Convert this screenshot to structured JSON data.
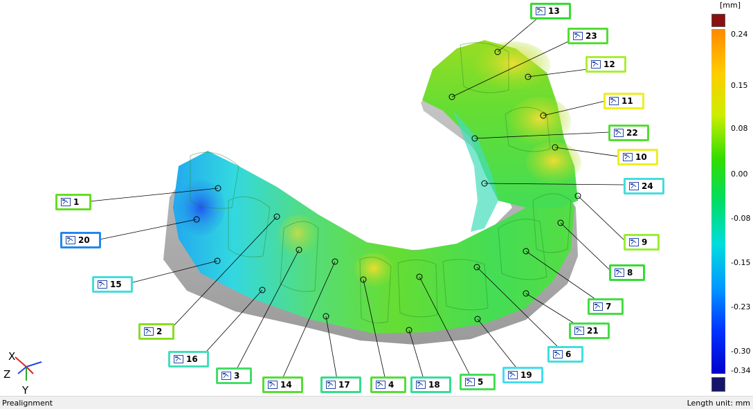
{
  "legend": {
    "unit": "[mm]",
    "ticks": [
      "0.24",
      "0.15",
      "0.08",
      "0.00",
      "-0.08",
      "-0.15",
      "-0.23",
      "-0.30",
      "-0.34"
    ],
    "colors": {
      "above": "#8b1010",
      "below": "#15156b",
      "scale": [
        "#ff8800",
        "#ffcc00",
        "#ccee00",
        "#33dd00",
        "#00dd66",
        "#00dddd",
        "#0099ff",
        "#0033ff",
        "#0000cc"
      ]
    }
  },
  "axes": {
    "x": "X",
    "y": "Y",
    "z": "Z"
  },
  "callouts": [
    {
      "id": "1",
      "color": "#66dd22"
    },
    {
      "id": "2",
      "color": "#88dd22"
    },
    {
      "id": "3",
      "color": "#44dd66"
    },
    {
      "id": "4",
      "color": "#55dd33"
    },
    {
      "id": "5",
      "color": "#44dd55"
    },
    {
      "id": "6",
      "color": "#44dddd"
    },
    {
      "id": "7",
      "color": "#44dd44"
    },
    {
      "id": "8",
      "color": "#33dd33"
    },
    {
      "id": "9",
      "color": "#99ee33"
    },
    {
      "id": "10",
      "color": "#eeee22"
    },
    {
      "id": "11",
      "color": "#eeee22"
    },
    {
      "id": "12",
      "color": "#aaee33"
    },
    {
      "id": "13",
      "color": "#33dd33"
    },
    {
      "id": "14",
      "color": "#55dd33"
    },
    {
      "id": "15",
      "color": "#44dddd"
    },
    {
      "id": "16",
      "color": "#44ddbb"
    },
    {
      "id": "17",
      "color": "#33dd88"
    },
    {
      "id": "18",
      "color": "#33dd99"
    },
    {
      "id": "19",
      "color": "#44ddee"
    },
    {
      "id": "20",
      "color": "#2288ee"
    },
    {
      "id": "21",
      "color": "#44dd44"
    },
    {
      "id": "22",
      "color": "#55dd33"
    },
    {
      "id": "23",
      "color": "#55dd33"
    },
    {
      "id": "24",
      "color": "#44dddd"
    }
  ],
  "status": {
    "left": "Prealignment",
    "right": "Length unit: mm"
  }
}
